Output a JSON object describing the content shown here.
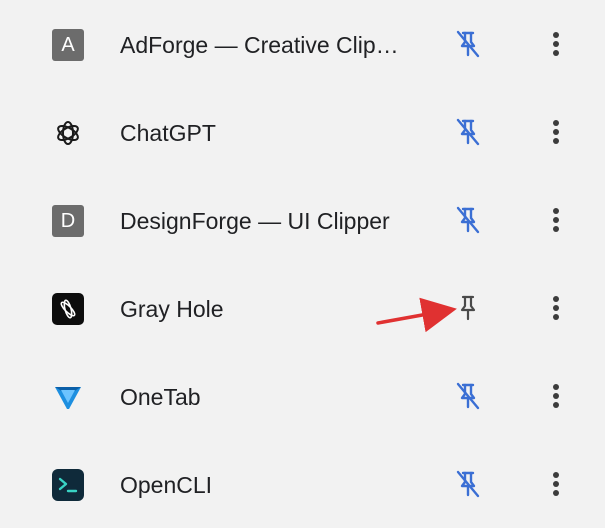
{
  "extensions": [
    {
      "name": "AdForge — Creative Clip…",
      "icon": "letter-a-icon",
      "icon_letter": "A",
      "pinned": false
    },
    {
      "name": "ChatGPT",
      "icon": "chatgpt-logo-icon",
      "pinned": false
    },
    {
      "name": "DesignForge — UI Clipper",
      "icon": "letter-d-icon",
      "icon_letter": "D",
      "pinned": false
    },
    {
      "name": "Gray Hole",
      "icon": "gray-hole-icon",
      "pinned": true
    },
    {
      "name": "OneTab",
      "icon": "onetab-funnel-icon",
      "pinned": false
    },
    {
      "name": "OpenCLI",
      "icon": "terminal-icon",
      "pinned": false
    }
  ],
  "colors": {
    "unpinned_icon": "#3b6fd4",
    "pinned_icon": "#4a4a4a",
    "annotation_arrow": "#e03131",
    "text": "#202124",
    "background": "#f2f2f2"
  },
  "annotation": {
    "type": "arrow",
    "points_to": "Gray Hole pin button"
  }
}
